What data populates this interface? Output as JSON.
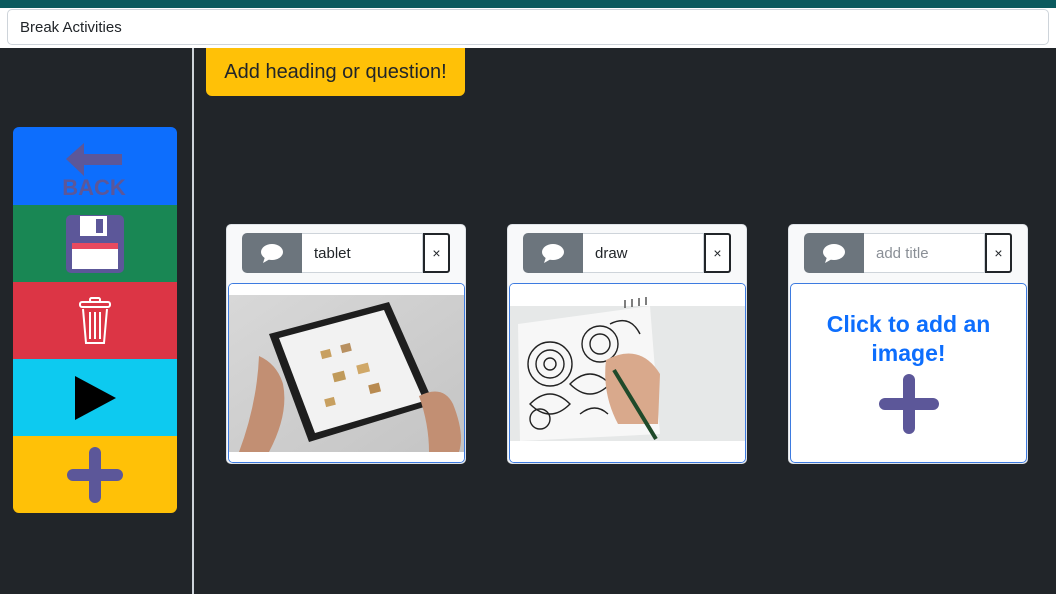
{
  "board": {
    "title": "Break Activities",
    "heading_button_label": "Add heading or question!"
  },
  "sidebar": {
    "back_label": "BACK",
    "colors": {
      "back": "#0d6efd",
      "save": "#198754",
      "delete": "#dc3545",
      "play": "#0dcaf0",
      "add": "#ffc107",
      "icon_purple": "#5c5799"
    },
    "items": [
      {
        "name": "back",
        "icon": "arrow-left-icon"
      },
      {
        "name": "save",
        "icon": "floppy-disk-icon"
      },
      {
        "name": "delete",
        "icon": "trash-icon"
      },
      {
        "name": "play",
        "icon": "play-icon"
      },
      {
        "name": "add",
        "icon": "plus-icon"
      }
    ]
  },
  "cards": [
    {
      "title": "tablet",
      "placeholder": "add title",
      "close_label": "×",
      "image": "hands-holding-tablet-photo"
    },
    {
      "title": "draw",
      "placeholder": "add title",
      "close_label": "×",
      "image": "hand-drawing-mandala-photo"
    },
    {
      "title": "",
      "placeholder": "add title",
      "close_label": "×",
      "image_prompt": "Click to add an image!"
    }
  ]
}
